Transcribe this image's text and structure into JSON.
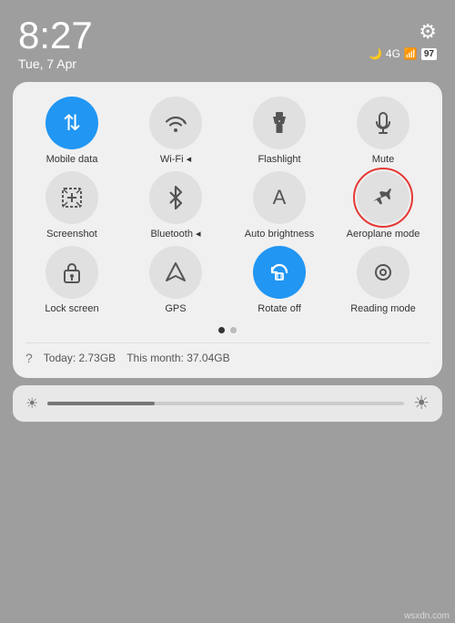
{
  "statusBar": {
    "time": "8:27",
    "date": "Tue, 7 Apr",
    "battery": "97",
    "signal": "4G"
  },
  "tiles": [
    {
      "id": "mobile-data",
      "label": "Mobile data",
      "icon": "⇅",
      "active": true
    },
    {
      "id": "wifi",
      "label": "Wi-Fi ◂",
      "icon": "📶",
      "active": false
    },
    {
      "id": "flashlight",
      "label": "Flashlight",
      "icon": "🔦",
      "active": false
    },
    {
      "id": "mute",
      "label": "Mute",
      "icon": "🔔",
      "active": false
    },
    {
      "id": "screenshot",
      "label": "Screenshot",
      "icon": "✂",
      "active": false
    },
    {
      "id": "bluetooth",
      "label": "Bluetooth ◂",
      "icon": "✱",
      "active": false
    },
    {
      "id": "auto-brightness",
      "label": "Auto brightness",
      "icon": "A",
      "active": false
    },
    {
      "id": "aeroplane-mode",
      "label": "Aeroplane mode",
      "icon": "✈",
      "active": false,
      "highlighted": true
    },
    {
      "id": "lock-screen",
      "label": "Lock screen",
      "icon": "🔒",
      "active": false
    },
    {
      "id": "gps",
      "label": "GPS",
      "icon": "◁",
      "active": false
    },
    {
      "id": "rotate-off",
      "label": "Rotate off",
      "icon": "🔄",
      "active": true
    },
    {
      "id": "reading-mode",
      "label": "Reading mode",
      "icon": "👁",
      "active": false
    }
  ],
  "dots": [
    {
      "active": true
    },
    {
      "active": false
    }
  ],
  "dataUsage": {
    "icon": "?",
    "today": "Today: 2.73GB",
    "month": "This month: 37.04GB"
  },
  "brightness": {
    "iconLeft": "☀",
    "iconRight": "☀",
    "fillPercent": 30
  },
  "watermark": "wsxdn.com"
}
